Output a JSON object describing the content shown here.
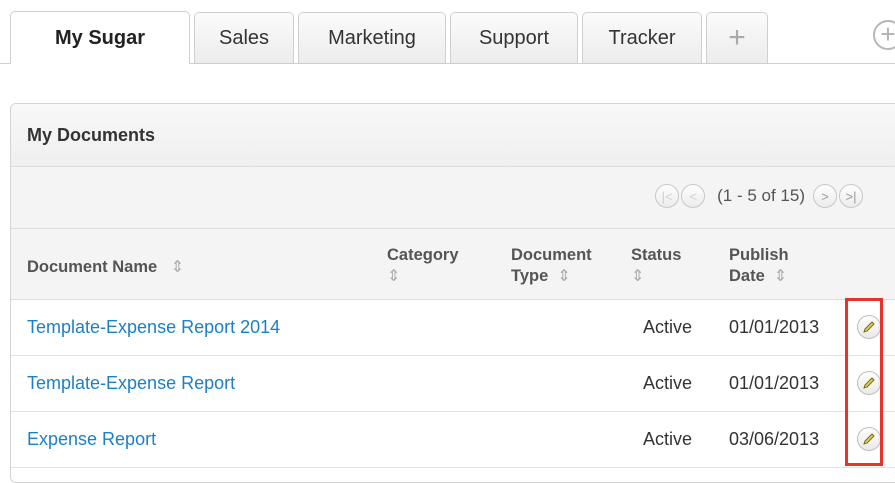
{
  "tabs": [
    {
      "label": "My Sugar",
      "active": true
    },
    {
      "label": "Sales",
      "active": false
    },
    {
      "label": "Marketing",
      "active": false
    },
    {
      "label": "Support",
      "active": false
    },
    {
      "label": "Tracker",
      "active": false
    },
    {
      "label": "+",
      "active": false
    }
  ],
  "dashlet": {
    "title": "My Documents",
    "pager": {
      "text": "(1 - 5 of 15)"
    },
    "columns": {
      "name": "Document Name",
      "category": "Category",
      "doc_type_line1": "Document",
      "doc_type_line2": "Type",
      "status": "Status",
      "publish_line1": "Publish",
      "publish_line2": "Date"
    },
    "rows": [
      {
        "name": "Template-Expense Report 2014",
        "status": "Active",
        "date": "01/01/2013"
      },
      {
        "name": "Template-Expense Report",
        "status": "Active",
        "date": "01/01/2013"
      },
      {
        "name": "Expense Report",
        "status": "Active",
        "date": "03/06/2013"
      }
    ]
  },
  "colors": {
    "link": "#1d7fc4",
    "highlight": "#e8332a",
    "edit_icon": "#e2d34a"
  }
}
